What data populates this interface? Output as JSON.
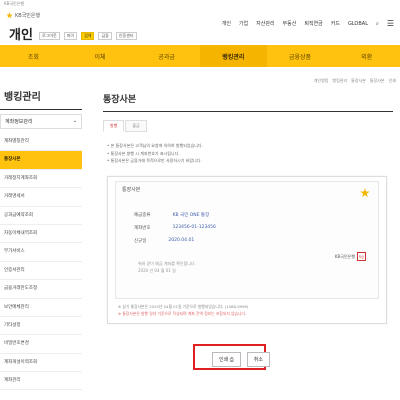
{
  "top_bar": {
    "url_text": "KB국민은행"
  },
  "header": {
    "logo_text": "KB국민은행",
    "title": "개인",
    "user_pills": [
      "로그아웃",
      "마이"
    ],
    "pills": [
      {
        "label": "검색",
        "highlight": true
      },
      {
        "label": "금융",
        "highlight": false
      },
      {
        "label": "인증센터",
        "highlight": false
      }
    ],
    "top_nav": [
      "개인",
      "기업",
      "자산관리",
      "부동산",
      "퇴직연금",
      "카드"
    ],
    "language": "GLOBAL",
    "brand_color": "#ffc20e"
  },
  "menu": {
    "items": [
      "조회",
      "이체",
      "공과금",
      "뱅킹관리",
      "금융상품",
      "외환"
    ],
    "active_index": 3
  },
  "breadcrumb": [
    "개인뱅킹",
    "뱅킹관리",
    "통장사본",
    "통장사본",
    "인쇄"
  ],
  "sidebar": {
    "title": "뱅킹관리",
    "select_label": "계좌정보관리",
    "items": [
      "계좌별칭관리",
      "통장사본",
      "거래정지계좌조회",
      "거래명세서",
      "공과금예약조회",
      "자동이체내역조회",
      "부가서비스",
      "인증서관리",
      "금융거래한도조정",
      "보안매체관리",
      "기타설정",
      "비밀번호변경",
      "계좌개설이력조회"
    ],
    "active_index": 1,
    "bottom_label": "계좌관리"
  },
  "content": {
    "page_title": "통장사본",
    "tabs": [
      "발행",
      "출금"
    ],
    "active_tab": 0,
    "notes": [
      "본 통장사본은 고객님의 요청에 의하여 발행되었습니다.",
      "통장사본 발행 시 계좌번호가 표시됩니다.",
      "통장사본은 금융거래 목적으로만 사용하시기 바랍니다."
    ]
  },
  "certificate": {
    "heading": "통장사본",
    "fields": [
      {
        "label": "예금종류",
        "value": "KB 국민 ONE 통장"
      },
      {
        "label": "계좌번호",
        "value": "123456-01-123456"
      },
      {
        "label": "신규일",
        "value": "2020.04.01"
      }
    ],
    "note_lines": [
      "위와 같이 예금 계좌를 확인합니다.",
      "2020 년 04 월 01 일"
    ],
    "seal_text": "KB국민은행",
    "seal_mark": "직인",
    "footer_lines": [
      "※ 상기 통장사본은 2020년 04월 01일 기준으로 발행되었습니다. (1588-9999)",
      "※ 통장사본은 발행 일자 기준으로 작성되며 계좌 잔액 정보는 포함되지 않습니다."
    ]
  },
  "buttons": [
    {
      "label": "인쇄"
    },
    {
      "label": "취소"
    }
  ],
  "highlight_color": "#e02020"
}
